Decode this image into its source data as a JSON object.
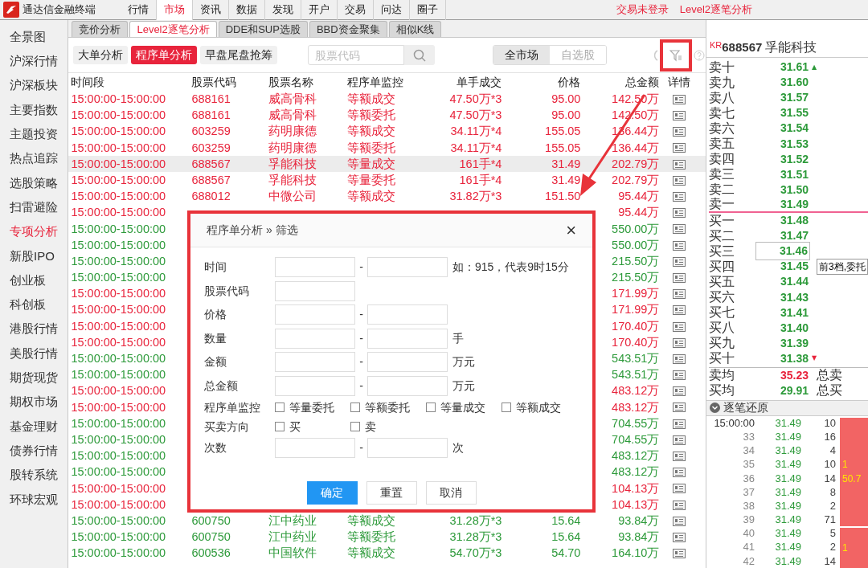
{
  "app_title": "通达信金融终端",
  "menu": [
    {
      "label": "行情",
      "selected": false
    },
    {
      "label": "市场",
      "selected": true
    },
    {
      "label": "资讯",
      "selected": false
    },
    {
      "label": "数据",
      "selected": false
    },
    {
      "label": "发现",
      "selected": false
    },
    {
      "label": "开户",
      "selected": false
    },
    {
      "label": "交易",
      "selected": false
    },
    {
      "label": "问达",
      "selected": false
    },
    {
      "label": "圈子",
      "selected": false
    }
  ],
  "status": [
    "交易未登录",
    "Level2逐笔分析"
  ],
  "sidebar": [
    {
      "label": "全景图",
      "selected": false
    },
    {
      "label": "沪深行情",
      "selected": false
    },
    {
      "label": "沪深板块",
      "selected": false
    },
    {
      "label": "主要指数",
      "selected": false
    },
    {
      "label": "主题投资",
      "selected": false
    },
    {
      "label": "热点追踪",
      "selected": false
    },
    {
      "label": "选股策略",
      "selected": false
    },
    {
      "label": "扫雷避险",
      "selected": false
    },
    {
      "label": "专项分析",
      "selected": true
    },
    {
      "label": "新股IPO",
      "selected": false
    },
    {
      "label": "创业板",
      "selected": false
    },
    {
      "label": "科创板",
      "selected": false
    },
    {
      "label": "港股行情",
      "selected": false
    },
    {
      "label": "美股行情",
      "selected": false
    },
    {
      "label": "期货现货",
      "selected": false
    },
    {
      "label": "期权市场",
      "selected": false
    },
    {
      "label": "基金理财",
      "selected": false
    },
    {
      "label": "债券行情",
      "selected": false
    },
    {
      "label": "股转系统",
      "selected": false
    },
    {
      "label": "环球宏观",
      "selected": false
    }
  ],
  "tabs": [
    {
      "label": "竞价分析",
      "selected": false
    },
    {
      "label": "Level2逐笔分析",
      "selected": true
    },
    {
      "label": "DDE和SUP选股",
      "selected": false
    },
    {
      "label": "BBD资金聚集",
      "selected": false
    },
    {
      "label": "相似K线",
      "selected": false
    }
  ],
  "sub_tabs": [
    {
      "label": "大单分析",
      "selected": false
    },
    {
      "label": "程序单分析",
      "selected": true
    },
    {
      "label": "早盘尾盘抢筹",
      "selected": false
    }
  ],
  "search": {
    "placeholder": "股票代码"
  },
  "scope": [
    {
      "label": "全市场",
      "selected": true
    },
    {
      "label": "自选股",
      "selected": false
    }
  ],
  "table": {
    "columns": [
      "时间段",
      "股票代码",
      "股票名称",
      "程序单监控",
      "单手成交",
      "价格",
      "总金额",
      "详情"
    ],
    "rows": [
      {
        "time": "15:00:00-15:00:00",
        "code": "688161",
        "name": "威高骨科",
        "monitor": "等额成交",
        "single": "47.50万*3",
        "price": "95.00",
        "total": "142.50万",
        "color": "#e8243c",
        "selected": false
      },
      {
        "time": "15:00:00-15:00:00",
        "code": "688161",
        "name": "威高骨科",
        "monitor": "等额委托",
        "single": "47.50万*3",
        "price": "95.00",
        "total": "142.50万",
        "color": "#e8243c",
        "selected": false
      },
      {
        "time": "15:00:00-15:00:00",
        "code": "603259",
        "name": "药明康德",
        "monitor": "等额成交",
        "single": "34.11万*4",
        "price": "155.05",
        "total": "136.44万",
        "color": "#e8243c",
        "selected": false
      },
      {
        "time": "15:00:00-15:00:00",
        "code": "603259",
        "name": "药明康德",
        "monitor": "等额委托",
        "single": "34.11万*4",
        "price": "155.05",
        "total": "136.44万",
        "color": "#e8243c",
        "selected": false
      },
      {
        "time": "15:00:00-15:00:00",
        "code": "688567",
        "name": "孚能科技",
        "monitor": "等量成交",
        "single": "161手*4",
        "price": "31.49",
        "total": "202.79万",
        "color": "#e8243c",
        "selected": true
      },
      {
        "time": "15:00:00-15:00:00",
        "code": "688567",
        "name": "孚能科技",
        "monitor": "等量委托",
        "single": "161手*4",
        "price": "31.49",
        "total": "202.79万",
        "color": "#e8243c",
        "selected": false
      },
      {
        "time": "15:00:00-15:00:00",
        "code": "688012",
        "name": "中微公司",
        "monitor": "等额成交",
        "single": "31.82万*3",
        "price": "151.50",
        "total": "95.44万",
        "color": "#e8243c",
        "selected": false
      },
      {
        "time": "15:00:00-15:00:00",
        "total": "95.44万",
        "color": "#e8243c",
        "selected": false
      },
      {
        "time": "15:00:00-15:00:00",
        "total": "550.00万",
        "color": "#2d9a3a",
        "selected": false
      },
      {
        "time": "15:00:00-15:00:00",
        "total": "550.00万",
        "color": "#2d9a3a",
        "selected": false
      },
      {
        "time": "15:00:00-15:00:00",
        "total": "215.50万",
        "color": "#2d9a3a",
        "selected": false
      },
      {
        "time": "15:00:00-15:00:00",
        "total": "215.50万",
        "color": "#2d9a3a",
        "selected": false
      },
      {
        "time": "15:00:00-15:00:00",
        "total": "171.99万",
        "color": "#e8243c",
        "selected": false
      },
      {
        "time": "15:00:00-15:00:00",
        "total": "171.99万",
        "color": "#e8243c",
        "selected": false
      },
      {
        "time": "15:00:00-15:00:00",
        "total": "170.40万",
        "color": "#e8243c",
        "selected": false
      },
      {
        "time": "15:00:00-15:00:00",
        "total": "170.40万",
        "color": "#e8243c",
        "selected": false
      },
      {
        "time": "15:00:00-15:00:00",
        "total": "543.51万",
        "color": "#2d9a3a",
        "selected": false
      },
      {
        "time": "15:00:00-15:00:00",
        "total": "543.51万",
        "color": "#2d9a3a",
        "selected": false
      },
      {
        "time": "15:00:00-15:00:00",
        "total": "483.12万",
        "color": "#e8243c",
        "selected": false
      },
      {
        "time": "15:00:00-15:00:00",
        "total": "483.12万",
        "color": "#e8243c",
        "selected": false
      },
      {
        "time": "15:00:00-15:00:00",
        "total": "704.55万",
        "color": "#2d9a3a",
        "selected": false
      },
      {
        "time": "15:00:00-15:00:00",
        "total": "704.55万",
        "color": "#2d9a3a",
        "selected": false
      },
      {
        "time": "15:00:00-15:00:00",
        "total": "483.12万",
        "color": "#2d9a3a",
        "selected": false
      },
      {
        "time": "15:00:00-15:00:00",
        "total": "483.12万",
        "color": "#2d9a3a",
        "selected": false
      },
      {
        "time": "15:00:00-15:00:00",
        "total": "104.13万",
        "color": "#e8243c",
        "selected": false
      },
      {
        "time": "15:00:00-15:00:00",
        "total": "104.13万",
        "color": "#e8243c",
        "selected": false
      },
      {
        "time": "15:00:00-15:00:00",
        "code": "600750",
        "name": "江中药业",
        "monitor": "等额成交",
        "single": "31.28万*3",
        "price": "15.64",
        "total": "93.84万",
        "color": "#2d9a3a",
        "selected": false
      },
      {
        "time": "15:00:00-15:00:00",
        "code": "600750",
        "name": "江中药业",
        "monitor": "等额委托",
        "single": "31.28万*3",
        "price": "15.64",
        "total": "93.84万",
        "color": "#2d9a3a",
        "selected": false
      },
      {
        "time": "15:00:00-15:00:00",
        "code": "600536",
        "name": "中国软件",
        "monitor": "等额成交",
        "single": "54.70万*3",
        "price": "54.70",
        "total": "164.10万",
        "color": "#2d9a3a",
        "selected": false
      }
    ]
  },
  "dialog": {
    "title": "程序单分析 » 筛选",
    "close": "×",
    "fields": [
      {
        "kind": "range",
        "label": "时间",
        "separator": "-",
        "suffix": "如：915，代表9时15分"
      },
      {
        "kind": "single",
        "label": "股票代码"
      },
      {
        "kind": "range",
        "label": "价格",
        "separator": "-"
      },
      {
        "kind": "range",
        "label": "数量",
        "separator": "-",
        "suffix": "手"
      },
      {
        "kind": "range",
        "label": "金额",
        "separator": "-",
        "suffix": "万元"
      },
      {
        "kind": "range",
        "label": "总金额",
        "separator": "-",
        "suffix": "万元"
      },
      {
        "kind": "checks",
        "label": "程序单监控",
        "options": [
          {
            "label": "等量委托",
            "checked": false
          },
          {
            "label": "等额委托",
            "checked": false
          },
          {
            "label": "等量成交",
            "checked": false
          },
          {
            "label": "等额成交",
            "checked": false
          }
        ]
      },
      {
        "kind": "checks",
        "label": "买卖方向",
        "options": [
          {
            "label": "买",
            "checked": false
          },
          {
            "label": "卖",
            "checked": false
          }
        ]
      },
      {
        "kind": "range",
        "label": "次数",
        "separator": "-",
        "suffix": "次"
      }
    ],
    "buttons": [
      {
        "label": "确定",
        "primary": true
      },
      {
        "label": "重置",
        "primary": false
      },
      {
        "label": "取消",
        "primary": false
      }
    ]
  },
  "quote": {
    "badge": "KR",
    "code": "688567",
    "name": "孚能科技",
    "levels": [
      {
        "label": "卖十",
        "price": "31.61",
        "arrow": "▲",
        "color": "#2d9a3a",
        "selected": false
      },
      {
        "label": "卖九",
        "price": "31.60",
        "selected": false
      },
      {
        "label": "卖八",
        "price": "31.57",
        "selected": false
      },
      {
        "label": "卖七",
        "price": "31.55",
        "selected": false
      },
      {
        "label": "卖六",
        "price": "31.54",
        "selected": false
      },
      {
        "label": "卖五",
        "price": "31.53",
        "selected": false
      },
      {
        "label": "卖四",
        "price": "31.52",
        "selected": false
      },
      {
        "label": "卖三",
        "price": "31.51",
        "selected": false
      },
      {
        "label": "卖二",
        "price": "31.50",
        "selected": false
      },
      {
        "label": "卖一",
        "price": "31.49",
        "selected": false
      },
      {
        "label": "买一",
        "price": "31.48",
        "selected": false
      },
      {
        "label": "买二",
        "price": "31.47",
        "selected": false
      },
      {
        "label": "买三",
        "price": "31.46",
        "selected": true
      },
      {
        "label": "买四",
        "price": "31.45",
        "selected": false
      },
      {
        "label": "买五",
        "price": "31.44",
        "selected": false
      },
      {
        "label": "买六",
        "price": "31.43",
        "selected": false
      },
      {
        "label": "买七",
        "price": "31.41",
        "selected": false
      },
      {
        "label": "买八",
        "price": "31.40",
        "selected": false
      },
      {
        "label": "买九",
        "price": "31.39",
        "selected": false
      },
      {
        "label": "买十",
        "price": "31.38",
        "arrow": "▼",
        "color": "#e8243c",
        "selected": false
      }
    ],
    "tooltip": "前3档,委托",
    "averages": [
      {
        "label": "卖均",
        "price": "35.23",
        "color": "#e8243c",
        "total_label": "总卖"
      },
      {
        "label": "买均",
        "price": "29.91",
        "color": "#2d9a3a",
        "total_label": "总买"
      }
    ]
  },
  "ticks": {
    "title": "逐笔还原",
    "rows": [
      {
        "time": "15:00:00",
        "price": "31.49",
        "volume": "10"
      },
      {
        "time": "33",
        "price": "31.49",
        "volume": "16"
      },
      {
        "time": "34",
        "price": "31.49",
        "volume": "4"
      },
      {
        "time": "35",
        "price": "31.49",
        "volume": "10"
      },
      {
        "time": "36",
        "price": "31.49",
        "volume": "14"
      },
      {
        "time": "37",
        "price": "31.49",
        "volume": "8"
      },
      {
        "time": "38",
        "price": "31.49",
        "volume": "2"
      },
      {
        "time": "39",
        "price": "31.49",
        "volume": "71"
      },
      {
        "time": "40",
        "price": "31.49",
        "volume": "5"
      },
      {
        "time": "41",
        "price": "31.49",
        "volume": "2"
      },
      {
        "time": "42",
        "price": "31.49",
        "volume": "14"
      }
    ],
    "blocks": [
      {
        "texts": [
          "1",
          "50.7"
        ]
      },
      {
        "texts": [
          "1"
        ]
      }
    ]
  }
}
